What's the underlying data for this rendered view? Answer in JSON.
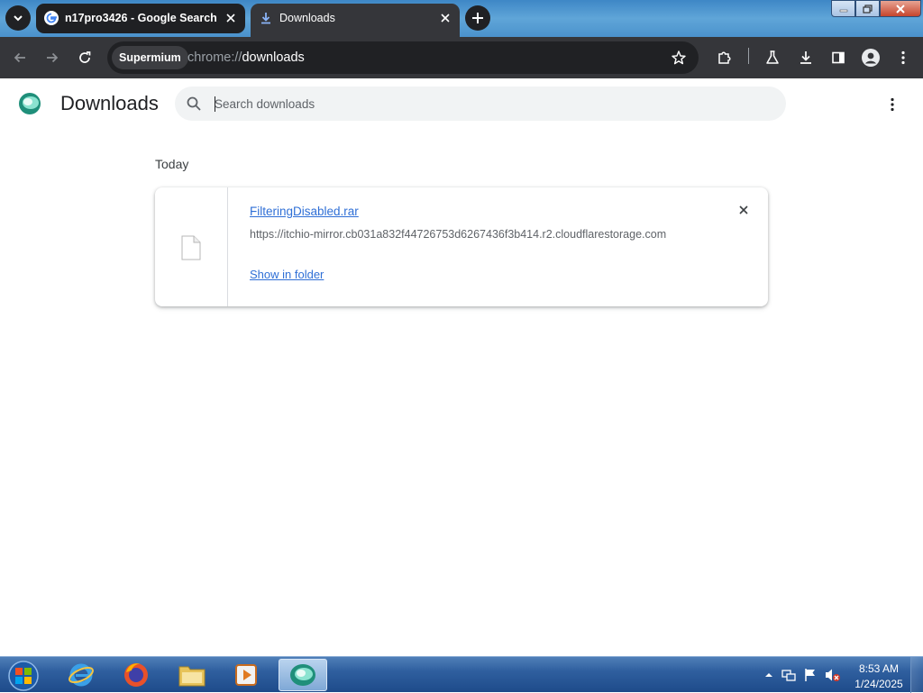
{
  "window": {
    "tabs": [
      {
        "title": "n17pro3426 - Google Search",
        "favicon": "google-g-icon",
        "active": false
      },
      {
        "title": "Downloads",
        "favicon": "download-arrow-icon",
        "active": true
      }
    ]
  },
  "toolbar": {
    "site_chip": "Supermium",
    "url_scheme": "chrome://",
    "url_path": "downloads"
  },
  "page": {
    "title": "Downloads",
    "search_placeholder": "Search downloads",
    "section_label": "Today",
    "downloads": [
      {
        "file_name": "FilteringDisabled.rar",
        "source_url": "https://itchio-mirror.cb031a832f44726753d6267436f3b414.r2.cloudflarestorage.com",
        "action_label": "Show in folder"
      }
    ]
  },
  "taskbar": {
    "apps": [
      "internet-explorer-icon",
      "firefox-icon",
      "file-explorer-icon",
      "media-player-icon",
      "supermium-icon"
    ],
    "clock_time": "8:53 AM",
    "clock_date": "1/24/2025"
  },
  "colors": {
    "chrome_dark": "#35363a",
    "tab_strip_blue": "#4b92cc",
    "link_blue": "#2f6fd6",
    "taskbar_blue": "#2f5f9f"
  }
}
